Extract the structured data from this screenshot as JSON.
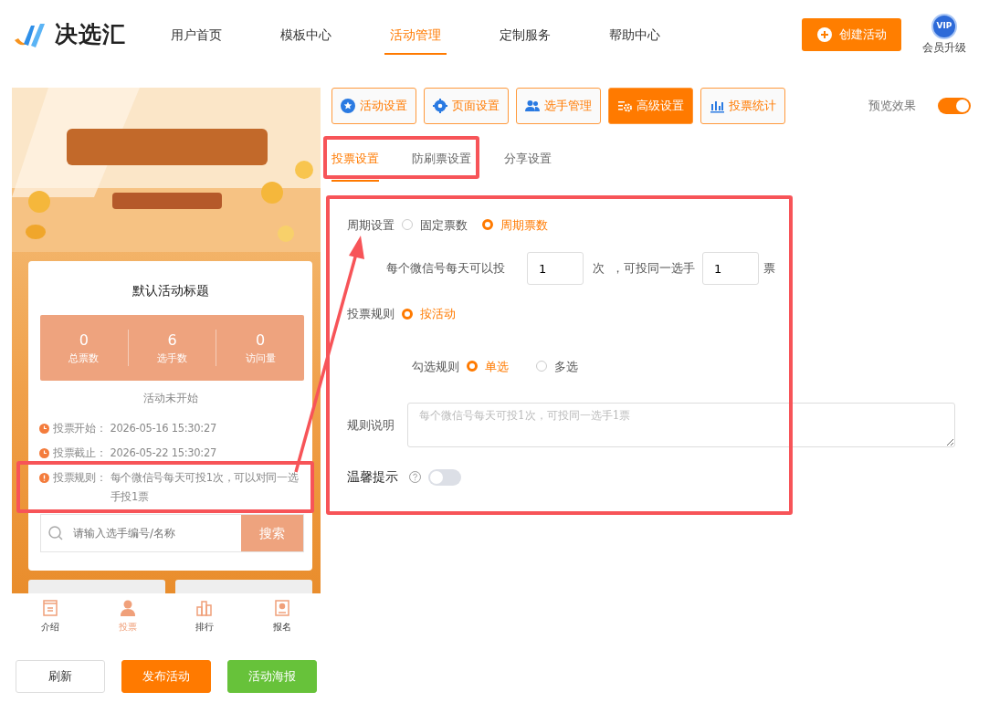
{
  "brand": {
    "name": "决选汇"
  },
  "nav": [
    {
      "label": "用户首页",
      "selected": false
    },
    {
      "label": "模板中心",
      "selected": false
    },
    {
      "label": "活动管理",
      "selected": true
    },
    {
      "label": "定制服务",
      "selected": false
    },
    {
      "label": "帮助中心",
      "selected": false
    }
  ],
  "create_button": "创建活动",
  "vip": {
    "badge": "VIP",
    "label": "会员升级"
  },
  "preview": {
    "activity_title": "默认活动标题",
    "stats": [
      {
        "value": "0",
        "label": "总票数"
      },
      {
        "value": "6",
        "label": "选手数"
      },
      {
        "value": "0",
        "label": "访问量"
      }
    ],
    "status": "活动未开始",
    "info": [
      {
        "kind": "time",
        "label": "投票开始：",
        "text": "2026-05-16 15:30:27"
      },
      {
        "kind": "time",
        "label": "投票截止：",
        "text": "2026-05-22 15:30:27"
      },
      {
        "kind": "rule",
        "label": "投票规则：",
        "text": "每个微信号每天可投1次，可以对同一选手投1票"
      }
    ],
    "search": {
      "placeholder": "请输入选手编号/名称",
      "button": "搜索"
    },
    "tabbar": [
      {
        "label": "介绍",
        "selected": false
      },
      {
        "label": "投票",
        "selected": true
      },
      {
        "label": "排行",
        "selected": false
      },
      {
        "label": "报名",
        "selected": false
      }
    ]
  },
  "preview_actions": [
    {
      "label": "刷新",
      "kind": "outline"
    },
    {
      "label": "发布活动",
      "kind": "orange"
    },
    {
      "label": "活动海报",
      "kind": "green"
    }
  ],
  "toolbar": [
    {
      "label": "活动设置",
      "selected": false
    },
    {
      "label": "页面设置",
      "selected": false
    },
    {
      "label": "选手管理",
      "selected": false
    },
    {
      "label": "高级设置",
      "selected": true
    },
    {
      "label": "投票统计",
      "selected": false
    }
  ],
  "preview_toggle": {
    "label": "预览效果",
    "on": true
  },
  "subtabs": [
    {
      "label": "投票设置",
      "selected": true
    },
    {
      "label": "防刷票设置",
      "selected": false
    },
    {
      "label": "分享设置",
      "selected": false
    }
  ],
  "form": {
    "period": {
      "label": "周期设置",
      "options": [
        {
          "label": "固定票数",
          "selected": false
        },
        {
          "label": "周期票数",
          "selected": true
        }
      ]
    },
    "per_day": {
      "prefix": "每个微信号每天可以投",
      "times_value": "1",
      "times_unit": "次",
      "middle": "，可投同一选手",
      "votes_value": "1",
      "votes_unit": "票"
    },
    "vote_rule": {
      "label": "投票规则",
      "options": [
        {
          "label": "按活动",
          "selected": true
        }
      ]
    },
    "check_rule": {
      "label": "勾选规则",
      "options": [
        {
          "label": "单选",
          "selected": true
        },
        {
          "label": "多选",
          "selected": false
        }
      ]
    },
    "description": {
      "label": "规则说明",
      "placeholder": "每个微信号每天可投1次，可投同一选手1票"
    },
    "tip": {
      "label": "温馨提示",
      "on": false
    }
  }
}
